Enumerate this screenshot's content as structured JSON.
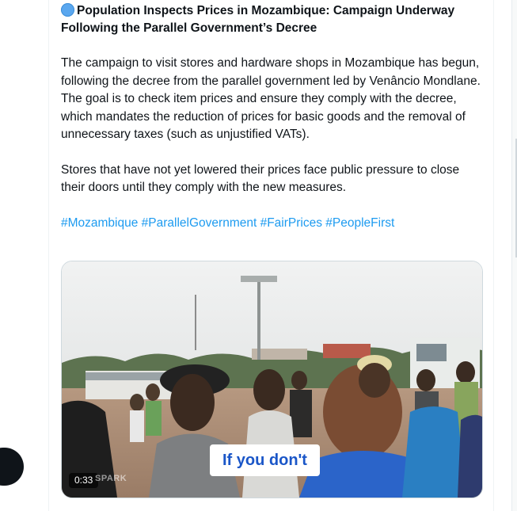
{
  "post": {
    "title": "Population Inspects Prices in Mozambique: Campaign Underway Following the Parallel Government’s Decree",
    "paragraph1": "The campaign to visit stores and hardware shops in Mozambique has begun, following the decree from the parallel government led by Venâncio Mondlane. The goal is to check item prices and ensure they comply with the decree, which mandates the reduction of prices for basic goods and the removal of unnecessary taxes (such as unjustified VATs).",
    "paragraph2": "Stores that have not yet lowered their prices face public pressure to close their doors until they comply with the new measures.",
    "hashtags": [
      "#Mozambique",
      "#ParallelGovernment",
      "#FairPrices",
      "#PeopleFirst"
    ]
  },
  "video": {
    "caption": "If you don't",
    "duration": "0:33",
    "watermark": "SPARK"
  },
  "colors": {
    "link": "#1d9bf0",
    "text": "#0f1419",
    "caption_text": "#1a56c8"
  },
  "icons": {
    "title_emoji": "blue-circle-icon"
  }
}
